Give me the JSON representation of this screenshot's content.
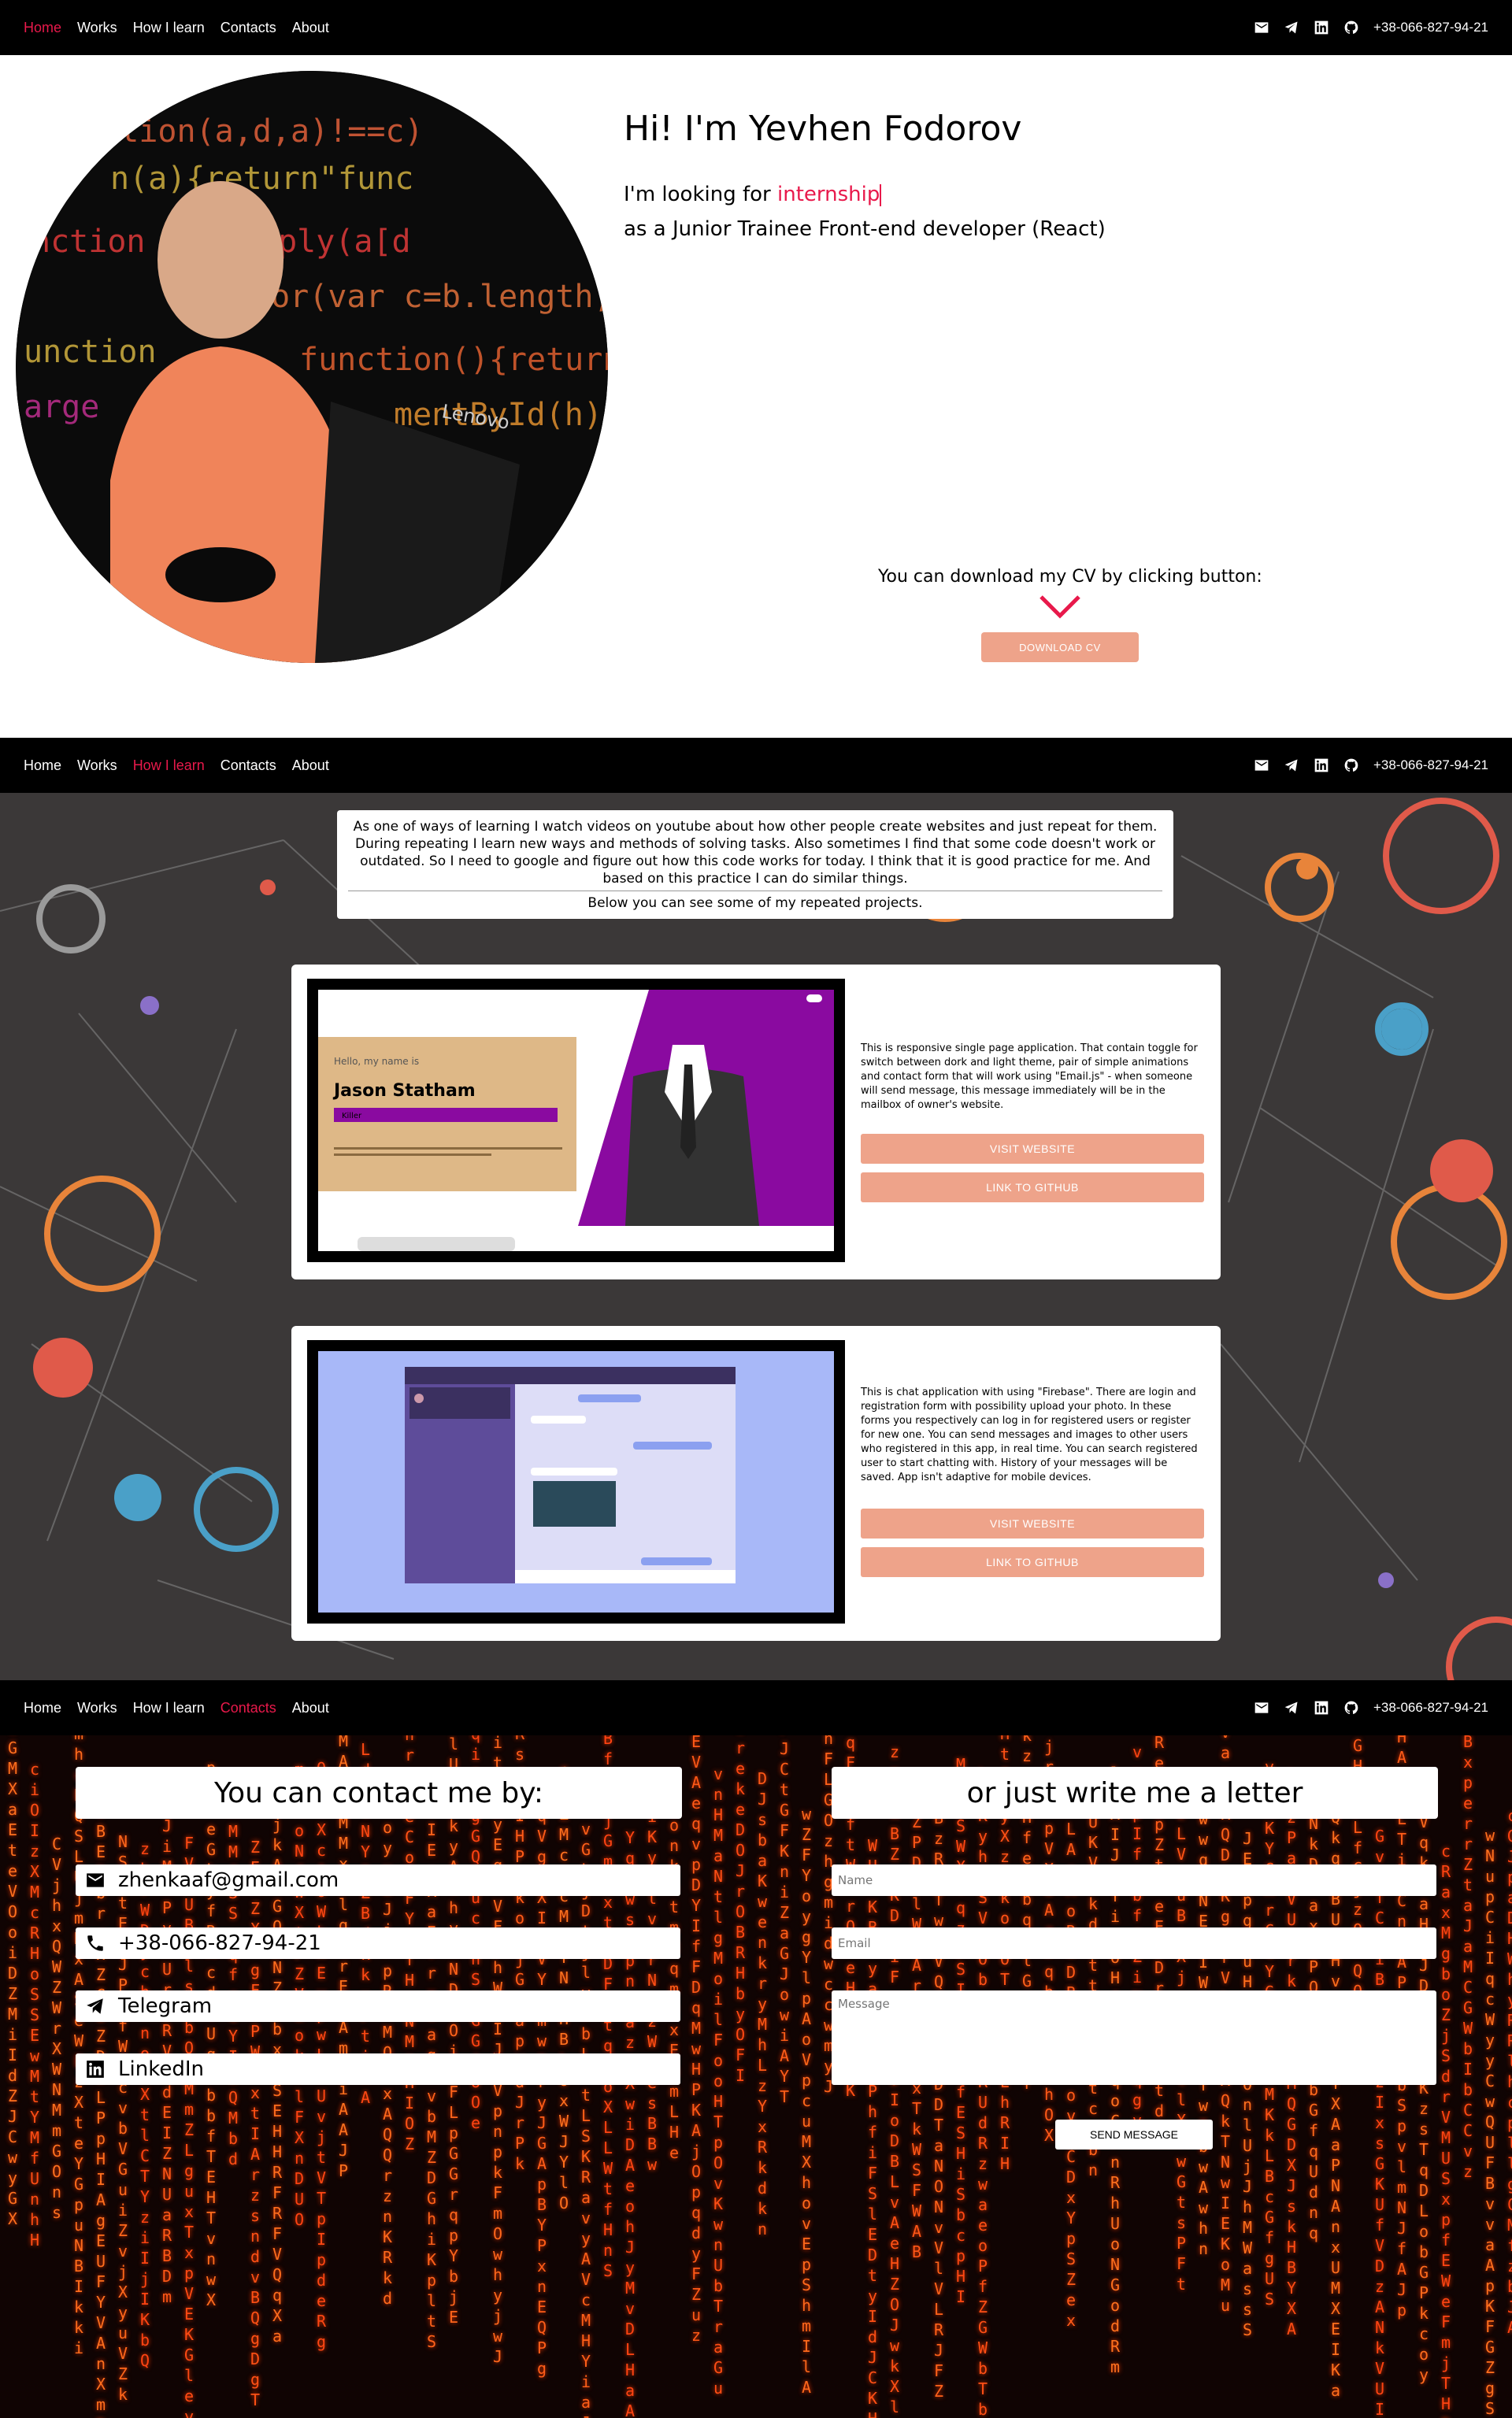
{
  "nav": {
    "items": [
      "Home",
      "Works",
      "How I learn",
      "Contacts",
      "About"
    ],
    "phone": "+38-066-827-94-21"
  },
  "hero": {
    "title": "Hi! I'm Yevhen Fodorov",
    "line1_prefix": "I'm looking for ",
    "line1_accent": "internship",
    "line2": "as a Junior Trainee Front-end developer (React)",
    "cv_text": "You can download my CV by clicking button:",
    "cv_button": "DOWNLOAD CV",
    "accent_color": "#e8194b"
  },
  "works": {
    "intro": "As one of ways of learning I watch videos on youtube about how other people create websites and just repeat for them. During repeating I learn new ways and methods of solving tasks. Also sometimes I find that some code doesn't work or outdated. So I need to google and figure out how this code works for today. I think that it is good practice for me. And based on this practice I can do similar things.",
    "intro_after": "Below you can see some of my repeated projects.",
    "projects": [
      {
        "desc": "This is responsive single page application. That contain toggle for switch between dork and light theme, pair of simple animations and contact form that will work using \"Email.js\" - when someone will send message, this message immediately will be in the mailbox of owner's website.",
        "visit": "VISIT WEBSITE",
        "github": "LINK TO GITHUB",
        "preview": {
          "greeting": "Hello, my name is",
          "name": "Jason Statham",
          "role": "Killer"
        }
      },
      {
        "desc": "This is chat application with using \"Firebase\". There are login and registration form with possibility upload your photo. In these forms you respectively can log in for registered users or register for new one. You can send messages and images to other users who registered in this app, in real time. You can search registered user to start chatting with. History of your messages will be saved. App isn't adaptive for mobile devices.",
        "visit": "VISIT WEBSITE",
        "github": "LINK TO GITHUB"
      }
    ]
  },
  "contacts": {
    "left_title": "You can contact me by:",
    "right_title": "or just write me a letter",
    "email": "zhenkaaf@gmail.com",
    "phone": "+38-066-827-94-21",
    "telegram": "Telegram",
    "linkedin": "LinkedIn",
    "name_placeholder": "Name",
    "email_placeholder": "Email",
    "message_placeholder": "Message",
    "send": "SEND MESSAGE"
  }
}
